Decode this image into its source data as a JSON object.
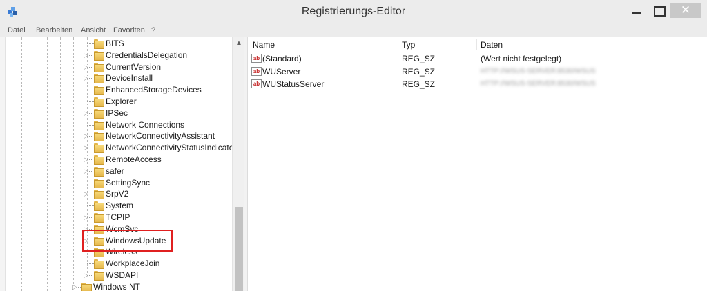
{
  "window": {
    "title": "Registrierungs-Editor",
    "close_glyph": "✕"
  },
  "menu": [
    "Datei",
    "Bearbeiten",
    "Ansicht",
    "Favoriten",
    "?"
  ],
  "tree": {
    "items": [
      {
        "label": "BITS",
        "expander": ""
      },
      {
        "label": "CredentialsDelegation",
        "expander": "▷"
      },
      {
        "label": "CurrentVersion",
        "expander": "▷"
      },
      {
        "label": "DeviceInstall",
        "expander": "▷"
      },
      {
        "label": "EnhancedStorageDevices",
        "expander": ""
      },
      {
        "label": "Explorer",
        "expander": ""
      },
      {
        "label": "IPSec",
        "expander": "▷"
      },
      {
        "label": "Network Connections",
        "expander": ""
      },
      {
        "label": "NetworkConnectivityAssistant",
        "expander": "▷"
      },
      {
        "label": "NetworkConnectivityStatusIndicator",
        "expander": "▷"
      },
      {
        "label": "RemoteAccess",
        "expander": "▷"
      },
      {
        "label": "safer",
        "expander": "▷"
      },
      {
        "label": "SettingSync",
        "expander": ""
      },
      {
        "label": "SrpV2",
        "expander": "▷"
      },
      {
        "label": "System",
        "expander": ""
      },
      {
        "label": "TCPIP",
        "expander": "▷"
      },
      {
        "label": "WcmSvc",
        "expander": "▷"
      },
      {
        "label": "WindowsUpdate",
        "expander": "▷"
      },
      {
        "label": "Wireless",
        "expander": ""
      },
      {
        "label": "WorkplaceJoin",
        "expander": ""
      },
      {
        "label": "WSDAPI",
        "expander": "▷"
      }
    ],
    "bottom_item": {
      "label": "Windows NT",
      "expander": "▷"
    },
    "selected": "WindowsUpdate"
  },
  "values": {
    "columns": {
      "name": "Name",
      "type": "Typ",
      "data": "Daten"
    },
    "icon_text": "ab",
    "rows": [
      {
        "name": "(Standard)",
        "type": "REG_SZ",
        "data": "(Wert nicht festgelegt)",
        "redacted": false
      },
      {
        "name": "WUServer",
        "type": "REG_SZ",
        "data": "HTTP://WSUS-SERVER:8530/WSUS",
        "redacted": true
      },
      {
        "name": "WUStatusServer",
        "type": "REG_SZ",
        "data": "HTTP://WSUS-SERVER:8530/WSUS",
        "redacted": true
      }
    ]
  },
  "colors": {
    "highlight": "#e02020",
    "folder": "#e6b84d"
  },
  "icons": {
    "app": "registry-editor-icon",
    "folder": "folder-icon",
    "value": "string-value-icon"
  }
}
